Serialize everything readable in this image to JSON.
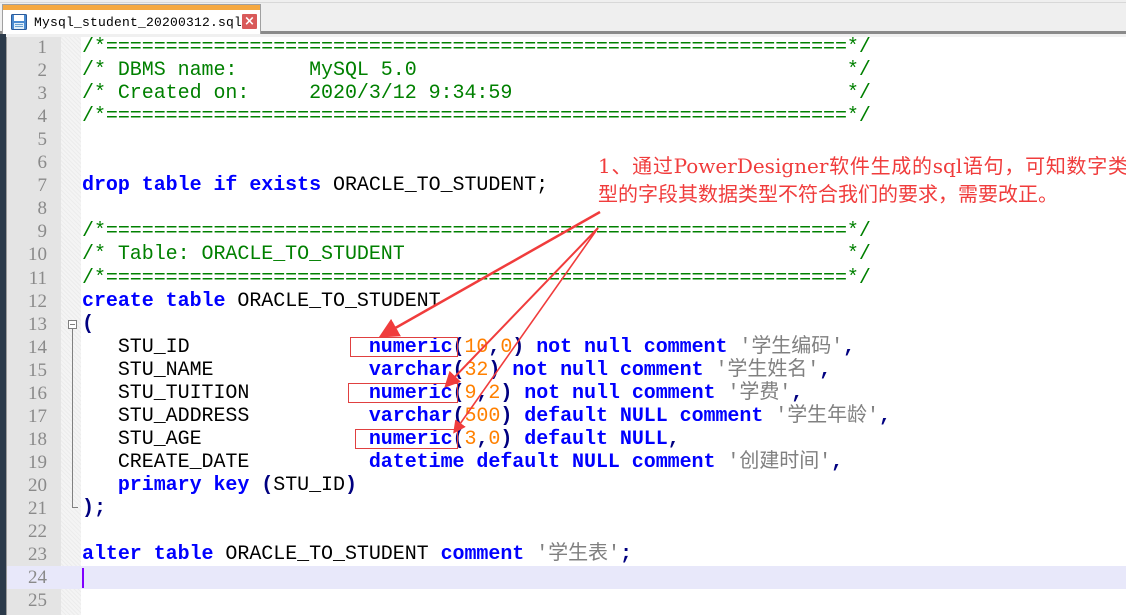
{
  "tab": {
    "filename": "Mysql_student_20200312.sql",
    "icon": "save-floppy-icon",
    "close_icon": "close-icon"
  },
  "editor": {
    "current_line": 24,
    "line_numbers": [
      "1",
      "2",
      "3",
      "4",
      "5",
      "6",
      "7",
      "8",
      "9",
      "10",
      "11",
      "12",
      "13",
      "14",
      "15",
      "16",
      "17",
      "18",
      "19",
      "20",
      "21",
      "22",
      "23",
      "24",
      "25"
    ],
    "lines": [
      [
        {
          "t": "c",
          "v": "/*==============================================================*/"
        }
      ],
      [
        {
          "t": "c",
          "v": "/* DBMS name:      MySQL 5.0                                    */"
        }
      ],
      [
        {
          "t": "c",
          "v": "/* Created on:     2020/3/12 9:34:59                            */"
        }
      ],
      [
        {
          "t": "c",
          "v": "/*==============================================================*/"
        }
      ],
      [],
      [],
      [
        {
          "t": "k",
          "v": "drop table if exists"
        },
        {
          "t": "p",
          "v": " ORACLE_TO_STUDENT;"
        }
      ],
      [],
      [
        {
          "t": "c",
          "v": "/*==============================================================*/"
        }
      ],
      [
        {
          "t": "c",
          "v": "/* Table: ORACLE_TO_STUDENT                                     */"
        }
      ],
      [
        {
          "t": "c",
          "v": "/*==============================================================*/"
        }
      ],
      [
        {
          "t": "k",
          "v": "create table"
        },
        {
          "t": "p",
          "v": " ORACLE_TO_STUDENT"
        }
      ],
      [
        {
          "t": "o",
          "v": "("
        }
      ],
      [
        {
          "t": "p",
          "v": "   STU_ID               "
        },
        {
          "t": "k",
          "v": "numeric"
        },
        {
          "t": "o",
          "v": "("
        },
        {
          "t": "n",
          "v": "10"
        },
        {
          "t": "o",
          "v": ","
        },
        {
          "t": "n",
          "v": "0"
        },
        {
          "t": "o",
          "v": ")"
        },
        {
          "t": "p",
          "v": " "
        },
        {
          "t": "k",
          "v": "not null comment"
        },
        {
          "t": "p",
          "v": " "
        },
        {
          "t": "s",
          "v": "'学生编码'"
        },
        {
          "t": "o",
          "v": ","
        }
      ],
      [
        {
          "t": "p",
          "v": "   STU_NAME             "
        },
        {
          "t": "k",
          "v": "varchar"
        },
        {
          "t": "o",
          "v": "("
        },
        {
          "t": "n",
          "v": "32"
        },
        {
          "t": "o",
          "v": ")"
        },
        {
          "t": "p",
          "v": " "
        },
        {
          "t": "k",
          "v": "not null comment"
        },
        {
          "t": "p",
          "v": " "
        },
        {
          "t": "s",
          "v": "'学生姓名'"
        },
        {
          "t": "o",
          "v": ","
        }
      ],
      [
        {
          "t": "p",
          "v": "   STU_TUITION          "
        },
        {
          "t": "k",
          "v": "numeric"
        },
        {
          "t": "o",
          "v": "("
        },
        {
          "t": "n",
          "v": "9"
        },
        {
          "t": "o",
          "v": ","
        },
        {
          "t": "n",
          "v": "2"
        },
        {
          "t": "o",
          "v": ")"
        },
        {
          "t": "p",
          "v": " "
        },
        {
          "t": "k",
          "v": "not null comment"
        },
        {
          "t": "p",
          "v": " "
        },
        {
          "t": "s",
          "v": "'学费'"
        },
        {
          "t": "o",
          "v": ","
        }
      ],
      [
        {
          "t": "p",
          "v": "   STU_ADDRESS          "
        },
        {
          "t": "k",
          "v": "varchar"
        },
        {
          "t": "o",
          "v": "("
        },
        {
          "t": "n",
          "v": "500"
        },
        {
          "t": "o",
          "v": ")"
        },
        {
          "t": "p",
          "v": " "
        },
        {
          "t": "k",
          "v": "default NULL comment"
        },
        {
          "t": "p",
          "v": " "
        },
        {
          "t": "s",
          "v": "'学生年龄'"
        },
        {
          "t": "o",
          "v": ","
        }
      ],
      [
        {
          "t": "p",
          "v": "   STU_AGE              "
        },
        {
          "t": "k",
          "v": "numeric"
        },
        {
          "t": "o",
          "v": "("
        },
        {
          "t": "n",
          "v": "3"
        },
        {
          "t": "o",
          "v": ","
        },
        {
          "t": "n",
          "v": "0"
        },
        {
          "t": "o",
          "v": ")"
        },
        {
          "t": "p",
          "v": " "
        },
        {
          "t": "k",
          "v": "default NULL"
        },
        {
          "t": "o",
          "v": ","
        }
      ],
      [
        {
          "t": "p",
          "v": "   CREATE_DATE          "
        },
        {
          "t": "k",
          "v": "datetime default NULL comment"
        },
        {
          "t": "p",
          "v": " "
        },
        {
          "t": "s",
          "v": "'创建时间'"
        },
        {
          "t": "o",
          "v": ","
        }
      ],
      [
        {
          "t": "p",
          "v": "   "
        },
        {
          "t": "k",
          "v": "primary key"
        },
        {
          "t": "p",
          "v": " "
        },
        {
          "t": "o",
          "v": "("
        },
        {
          "t": "p",
          "v": "STU_ID"
        },
        {
          "t": "o",
          "v": ")"
        }
      ],
      [
        {
          "t": "o",
          "v": ");"
        }
      ],
      [],
      [
        {
          "t": "k",
          "v": "alter table"
        },
        {
          "t": "p",
          "v": " ORACLE_TO_STUDENT "
        },
        {
          "t": "k",
          "v": "comment"
        },
        {
          "t": "p",
          "v": " "
        },
        {
          "t": "s",
          "v": "'学生表'"
        },
        {
          "t": "o",
          "v": ";"
        }
      ],
      [],
      []
    ]
  },
  "annotation": {
    "text": "1、通过PowerDesigner软件生成的sql语句，可知数字类型的字段其数据类型不符合我们的要求，需要改正。",
    "color": "#f03c3c",
    "highlighted_lines": [
      14,
      16,
      18
    ]
  },
  "colors": {
    "comment": "#008000",
    "keyword": "#0000ff",
    "number": "#ff8000",
    "string": "#808080",
    "tab_accent": "#f5a840",
    "current_line_bg": "#e8e8fa"
  }
}
